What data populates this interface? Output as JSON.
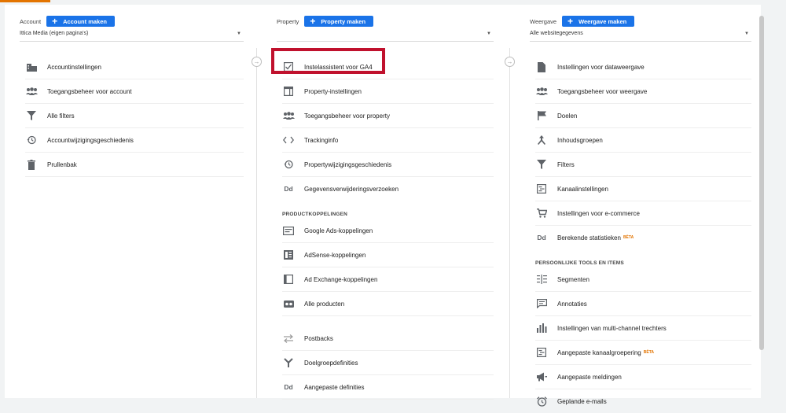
{
  "account": {
    "label": "Account",
    "button": "Account maken",
    "selector": "Ittica Media (eigen pagina's)",
    "items": [
      {
        "label": "Accountinstellingen"
      },
      {
        "label": "Toegangsbeheer voor account"
      },
      {
        "label": "Alle filters"
      },
      {
        "label": "Accountwijzigingsgeschiedenis"
      },
      {
        "label": "Prullenbak"
      }
    ]
  },
  "property": {
    "label": "Property",
    "button": "Property maken",
    "selector": "",
    "items": [
      {
        "label": "Instelassistent voor GA4"
      },
      {
        "label": "Property-instellingen"
      },
      {
        "label": "Toegangsbeheer voor property"
      },
      {
        "label": "Trackinginfo"
      },
      {
        "label": "Propertywijzigingsgeschiedenis"
      },
      {
        "label": "Gegevensverwijderingsverzoeken"
      }
    ],
    "section_title": "PRODUCTKOPPELINGEN",
    "links": [
      {
        "label": "Google Ads-koppelingen"
      },
      {
        "label": "AdSense-koppelingen"
      },
      {
        "label": "Ad Exchange-koppelingen"
      },
      {
        "label": "Alle producten"
      }
    ],
    "more": [
      {
        "label": "Postbacks"
      },
      {
        "label": "Doelgroepdefinities"
      },
      {
        "label": "Aangepaste definities"
      }
    ]
  },
  "view": {
    "label": "Weergave",
    "button": "Weergave maken",
    "selector": "Alle websitegegevens",
    "items": [
      {
        "label": "Instellingen voor dataweergave"
      },
      {
        "label": "Toegangsbeheer voor weergave"
      },
      {
        "label": "Doelen"
      },
      {
        "label": "Inhoudsgroepen"
      },
      {
        "label": "Filters"
      },
      {
        "label": "Kanaalinstellingen"
      },
      {
        "label": "Instellingen voor e-commerce"
      },
      {
        "label": "Berekende statistieken",
        "badge": "BÈTA"
      }
    ],
    "section_title": "PERSOONLIJKE TOOLS EN ITEMS",
    "tools": [
      {
        "label": "Segmenten"
      },
      {
        "label": "Annotaties"
      },
      {
        "label": "Instellingen van multi-channel trechters"
      },
      {
        "label": "Aangepaste kanaalgroepering",
        "badge": "BÈTA"
      },
      {
        "label": "Aangepaste meldingen"
      },
      {
        "label": "Geplande e-mails"
      }
    ]
  },
  "colors": {
    "accent": "#1a73e8",
    "highlight": "#c0112d",
    "beta": "#e37400"
  }
}
